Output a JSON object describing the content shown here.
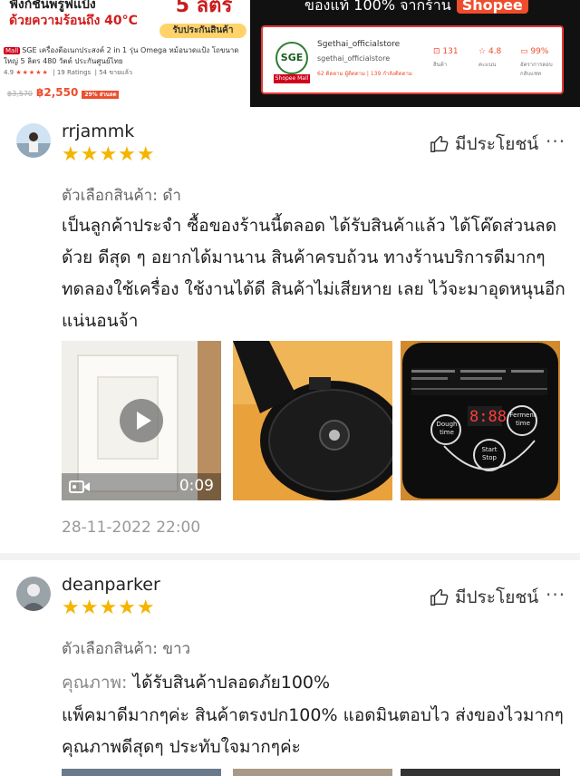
{
  "product": {
    "promo_line1": "ฟังก์ชันพรูฟแป้ง",
    "promo_line2": "ด้วยความร้อนถึง 40°C",
    "promo_box": "5 ลิตร",
    "warranty": "รับประกันสินค้า",
    "mall_badge": "Mall",
    "title": "SGE เครื่องตีอเนกประสงค์ 2 in 1 รุ่น Omega หม้อนวดแป้ง โถขนาดใหญ่ 5 ลิตร 480 วัตต์ ประกันศูนย์ไทย",
    "rating": "4.9",
    "rating_stars": "★★★★★",
    "ratings_count": "19 Ratings",
    "sold": "54 ขายแล้ว",
    "old_price": "฿3,570",
    "price": "฿2,550",
    "discount": "29% ส่วนลด"
  },
  "shop": {
    "banner_text": "ของแท้ 100% จากร้าน",
    "shopee_label": "Shopee",
    "logo_text": "SGE",
    "mall_label": "Shopee Mall",
    "name": "Sgethai_officialstore",
    "handle": "sgethai_officialstore",
    "stats_line": "62 ติดตาม ผู้ติดตาม | 139 กำลังติดตาม",
    "products_value": "131",
    "products_label": "สินค้า",
    "rating_value": "4.8",
    "rating_label": "คะแนน",
    "chat_value": "99%",
    "chat_label": "อัตราการตอบกลับแชท"
  },
  "reviews": [
    {
      "username": "rrjammk",
      "stars": "★★★★★",
      "helpful_label": "มีประโยชน์",
      "more": "···",
      "variant": "ตัวเลือกสินค้า: ดำ",
      "text": "เป็นลูกค้าประจำ ซื้อของร้านนี้ตลอด ได้รับสินค้าแล้ว ได้โค๊ดส่วนลดด้วย ดีสุด ๆ อยากได้มานาน สินค้าครบถ้วน ทางร้านบริการดีมากๆ ทดลองใช้เครื่อง ใช้งานได้ดี สินค้าไม่เสียหาย เลย ไว้จะมาอุดหนุนอีกแน่นอนจ้า",
      "video_duration": "0:09",
      "panel_dough": "Dough time",
      "panel_ferment": "Ferment time",
      "panel_start": "Start Stop",
      "panel_display": "8:88",
      "date": "28-11-2022 22:00"
    },
    {
      "username": "deanparker",
      "stars": "★★★★★",
      "helpful_label": "มีประโยชน์",
      "more": "···",
      "variant": "ตัวเลือกสินค้า: ขาว",
      "quality_label": "คุณภาพ:",
      "quality_value": "ได้รับสินค้าปลอดภัย100%",
      "text": "แพ็คมาดีมากๆค่ะ สินค้าตรงปก100% แอดมินตอบไว ส่งของไวมากๆ คุณภาพดีสุดๆ ประทับใจมากๆค่ะ"
    }
  ],
  "colors": {
    "star": "#f5b400",
    "shopee": "#ee4d2d",
    "divider": "#f2f2f2"
  }
}
